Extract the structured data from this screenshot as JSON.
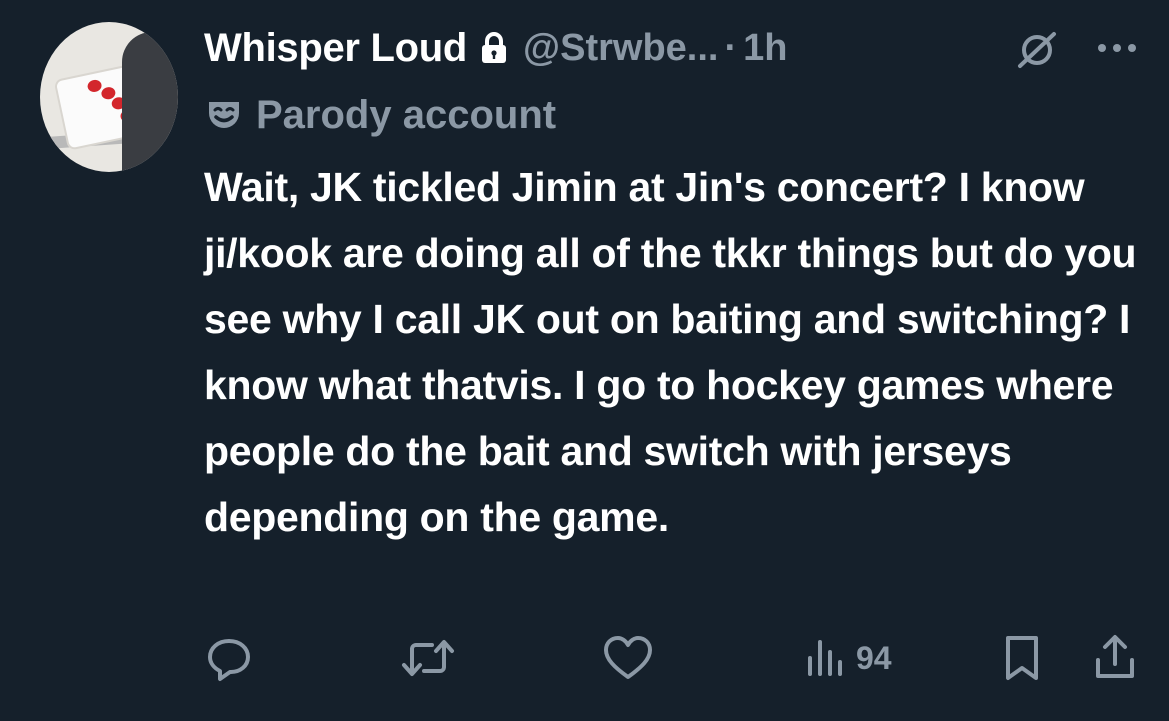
{
  "tweet": {
    "display_name": "Whisper Loud",
    "handle": "@Strwbe...",
    "separator": "·",
    "time": "1h",
    "badge_label": "Parody account",
    "text": "Wait, JK tickled Jimin at Jin's concert? I know ji/kook are doing all of the tkkr things but do you see why I call JK out on baiting and switching? I know what thatvis. I go to hockey games where people do the bait and switch with jerseys depending on the game."
  },
  "actions": {
    "reply_icon": "reply-icon",
    "retweet_icon": "retweet-icon",
    "like_icon": "heart-icon",
    "views_icon": "views-icon",
    "views_count": "94",
    "bookmark_icon": "bookmark-icon",
    "share_icon": "share-icon"
  },
  "colors": {
    "background": "#15202b",
    "primary_text": "#ffffff",
    "secondary_text": "#8b98a5"
  }
}
